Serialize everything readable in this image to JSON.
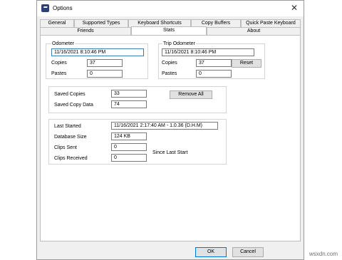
{
  "window": {
    "title": "Options"
  },
  "tabs_back": [
    "General",
    "Supported Types",
    "Keyboard Shortcuts",
    "Copy Buffers",
    "Quick Paste Keyboard"
  ],
  "tabs_front": [
    "Friends",
    "Stats",
    "About"
  ],
  "active_tab": "Stats",
  "odometer": {
    "group_label": "Odometer",
    "date": "11/16/2021 8:10:46 PM",
    "copies_label": "Copies",
    "copies": "37",
    "pastes_label": "Pastes",
    "pastes": "0"
  },
  "trip_odometer": {
    "group_label": "Trip Odometer",
    "date": "11/16/2021 8:10:46 PM",
    "copies_label": "Copies",
    "copies": "37",
    "pastes_label": "Pastes",
    "pastes": "0",
    "reset_label": "Reset"
  },
  "saved": {
    "copies_label": "Saved Copies",
    "copies": "33",
    "data_label": "Saved Copy Data",
    "data": "74",
    "remove_all_label": "Remove All"
  },
  "info": {
    "last_started_label": "Last Started",
    "last_started": "11/16/2021 2:17:40 AM  -  1.0.36 (D.H.M)",
    "db_size_label": "Database Size",
    "db_size": "124 KB",
    "clips_sent_label": "Clips Sent",
    "clips_sent": "0",
    "clips_received_label": "Clips Received",
    "clips_received": "0",
    "since_label": "Since Last Start"
  },
  "buttons": {
    "ok": "OK",
    "cancel": "Cancel"
  },
  "watermark": "wsxdn.com"
}
